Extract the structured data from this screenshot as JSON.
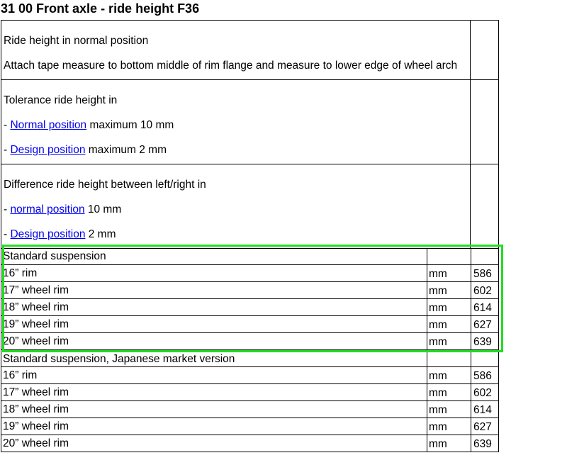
{
  "title": "31 00 Front axle - ride height F36",
  "blocks": {
    "normal": {
      "line1": "Ride height in normal position",
      "line2": "Attach tape measure to bottom middle of rim flange and measure to lower edge of wheel arch"
    },
    "tolerance": {
      "heading": "Tolerance ride height in",
      "items": [
        {
          "prefix": "- ",
          "link": "Normal position",
          "suffix": " maximum 10 mm"
        },
        {
          "prefix": "- ",
          "link": "Design position",
          "suffix": " maximum 2 mm"
        }
      ]
    },
    "difference": {
      "heading": "Difference ride height between left/right in",
      "items": [
        {
          "prefix": "- ",
          "link": "normal position",
          "suffix": " 10 mm"
        },
        {
          "prefix": "- ",
          "link": "Design position",
          "suffix": " 2 mm"
        }
      ]
    }
  },
  "table": {
    "sections": [
      {
        "heading": "Standard suspension",
        "rows": [
          {
            "rim": "16” rim",
            "unit": "mm",
            "value": "586"
          },
          {
            "rim": "17” wheel rim",
            "unit": "mm",
            "value": "602"
          },
          {
            "rim": "18” wheel rim",
            "unit": "mm",
            "value": "614"
          },
          {
            "rim": "19” wheel rim",
            "unit": "mm",
            "value": "627"
          },
          {
            "rim": "20” wheel rim",
            "unit": "mm",
            "value": "639"
          }
        ]
      },
      {
        "heading": "Standard suspension, Japanese market version",
        "rows": [
          {
            "rim": "16” rim",
            "unit": "mm",
            "value": "586"
          },
          {
            "rim": "17” wheel rim",
            "unit": "mm",
            "value": "602"
          },
          {
            "rim": "18” wheel rim",
            "unit": "mm",
            "value": "614"
          },
          {
            "rim": "19” wheel rim",
            "unit": "mm",
            "value": "627"
          },
          {
            "rim": "20” wheel rim",
            "unit": "mm",
            "value": "639"
          }
        ]
      }
    ]
  },
  "highlight_color": "#22dd22",
  "link_color": "#0000ee"
}
